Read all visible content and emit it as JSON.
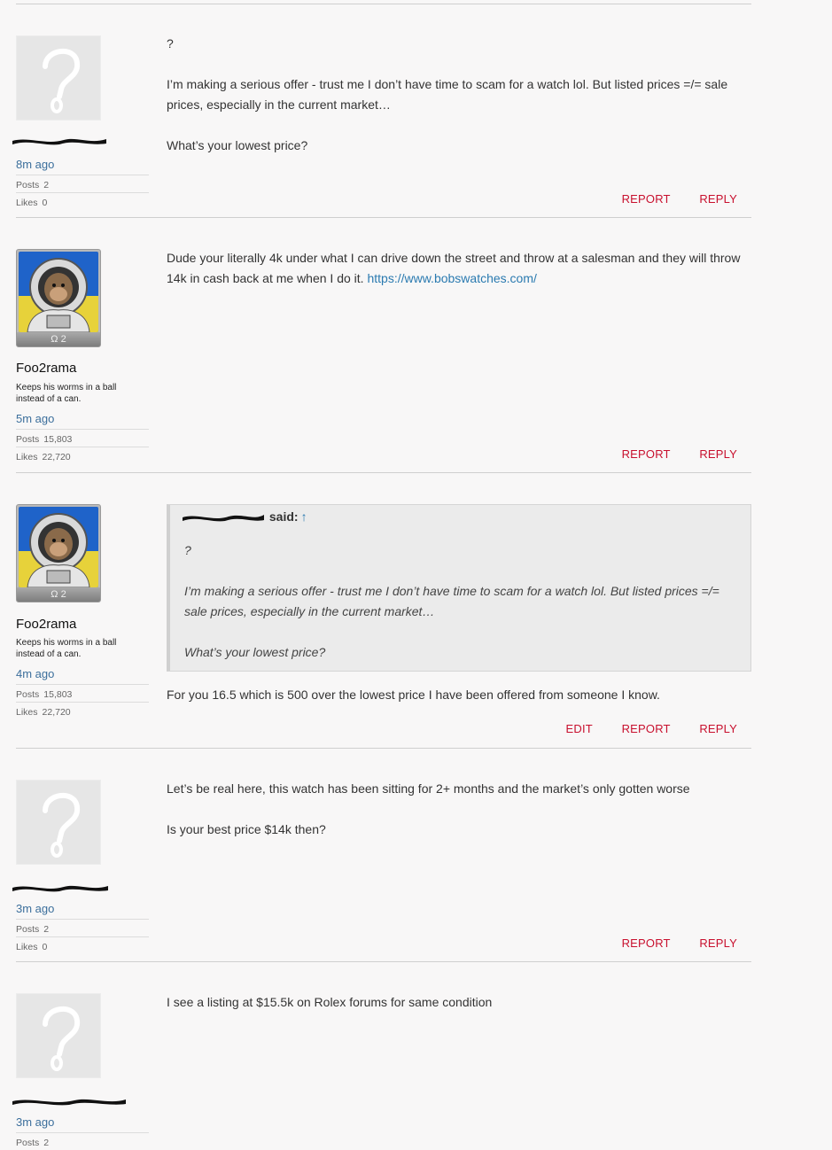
{
  "actions": {
    "edit": "EDIT",
    "report": "REPORT",
    "reply": "REPLY",
    "posts_label": "Posts",
    "likes_label": "Likes",
    "said_label": "said:",
    "quote_arrow": "↑"
  },
  "posts": [
    {
      "author": "",
      "author_redacted": true,
      "time": "8m ago",
      "posts": "2",
      "likes": "0",
      "paragraphs": [
        "?",
        "I’m making a serious offer - trust me I don’t have time to scam for a watch lol. But listed prices =/= sale prices, especially in the current market…",
        "What’s your lowest price?"
      ]
    },
    {
      "author": "Foo2rama",
      "rank": "Ω 2",
      "title": "Keeps his worms in a ball instead of a can.",
      "time": "5m ago",
      "posts": "15,803",
      "likes": "22,720",
      "text": "Dude your literally 4k under what I can drive down the street and throw at a salesman and they will throw 14k in cash back at me when I do it.",
      "link": "https://www.bobswatches.com/"
    },
    {
      "author": "Foo2rama",
      "rank": "Ω 2",
      "title": "Keeps his worms in a ball instead of a can.",
      "time": "4m ago",
      "posts": "15,803",
      "likes": "22,720",
      "quote_paragraphs": [
        "?",
        "I’m making a serious offer - trust me I don’t have time to scam for a watch lol. But listed prices =/= sale prices, especially in the current market…",
        "What’s your lowest price?"
      ],
      "text": "For you 16.5 which is 500 over the lowest price I have been offered from someone I know."
    },
    {
      "author": "",
      "author_redacted": true,
      "time": "3m ago",
      "posts": "2",
      "likes": "0",
      "paragraphs": [
        "Let’s be real here, this watch has been sitting for 2+ months and the market’s only gotten worse",
        "Is your best price $14k then?"
      ]
    },
    {
      "author": "",
      "author_redacted": true,
      "time": "3m ago",
      "posts": "2",
      "paragraphs": [
        "I see a listing at $15.5k on Rolex forums for same condition"
      ]
    }
  ]
}
